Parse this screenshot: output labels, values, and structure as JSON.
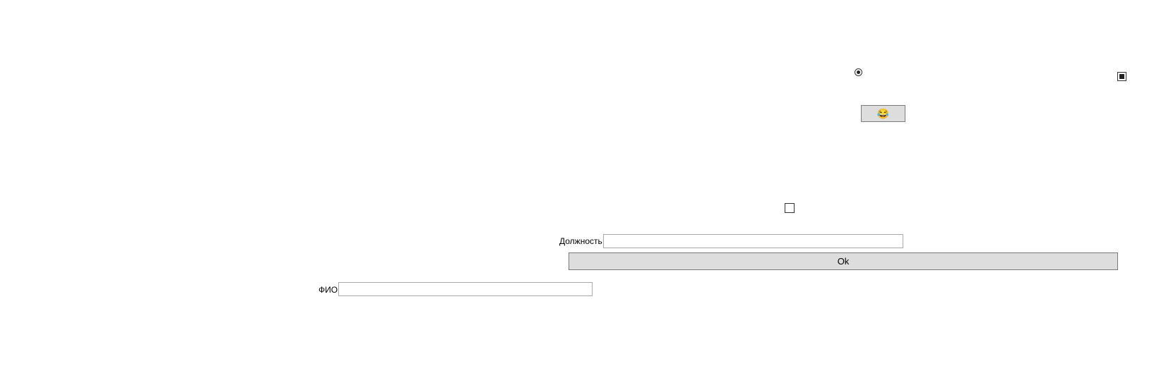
{
  "form": {
    "position_label": "Должность",
    "position_value": "",
    "position_placeholder": "",
    "fio_label": "ФИО",
    "fio_value": "",
    "fio_placeholder": "",
    "ok_label": "Ok",
    "emoji_button_label": "😂",
    "radio_checked": true,
    "top_checkbox_checked": true,
    "middle_checkbox_checked": false
  }
}
